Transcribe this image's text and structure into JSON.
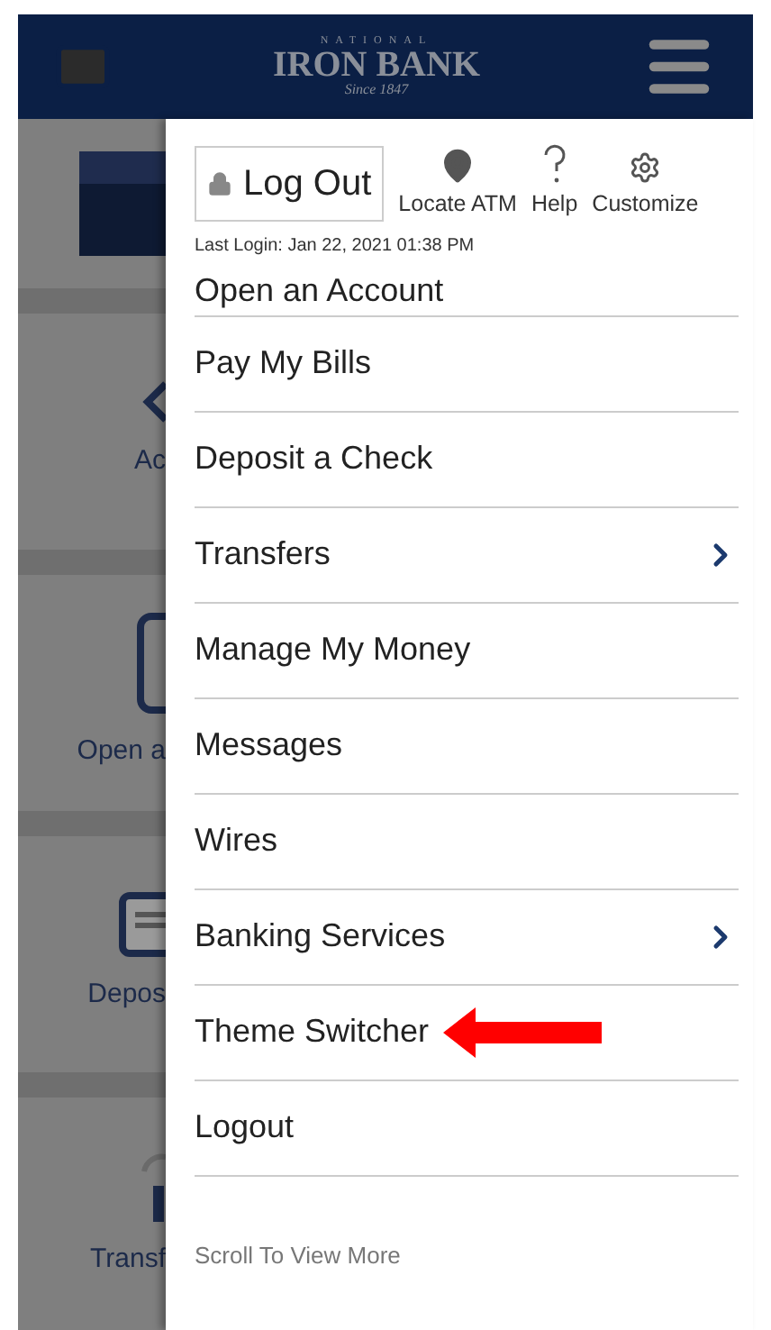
{
  "header": {
    "logo": {
      "top": "NATIONAL",
      "main": "IRON BANK",
      "tagline": "Since 1847"
    }
  },
  "background_tiles": [
    {
      "label": "Ac",
      "kind": "arrows"
    },
    {
      "label": "Open a",
      "kind": "card"
    },
    {
      "label": "Depos",
      "kind": "check"
    },
    {
      "label": "Transf",
      "kind": "transfer"
    }
  ],
  "menu": {
    "logout_button": "Log Out",
    "actions": [
      {
        "label": "Locate ATM",
        "kind": "pin"
      },
      {
        "label": "Help",
        "kind": "help"
      },
      {
        "label": "Customize",
        "kind": "gear"
      }
    ],
    "last_login": "Last Login: Jan 22, 2021 01:38 PM",
    "items": [
      {
        "label": "Open an Account",
        "has_children": false,
        "highlighted": false
      },
      {
        "label": "Pay My Bills",
        "has_children": false,
        "highlighted": false
      },
      {
        "label": "Deposit a Check",
        "has_children": false,
        "highlighted": false
      },
      {
        "label": "Transfers",
        "has_children": true,
        "highlighted": false
      },
      {
        "label": "Manage My Money",
        "has_children": false,
        "highlighted": false
      },
      {
        "label": "Messages",
        "has_children": false,
        "highlighted": false
      },
      {
        "label": "Wires",
        "has_children": false,
        "highlighted": false
      },
      {
        "label": "Banking Services",
        "has_children": true,
        "highlighted": false
      },
      {
        "label": "Theme Switcher",
        "has_children": false,
        "highlighted": true
      },
      {
        "label": "Logout",
        "has_children": false,
        "highlighted": false
      }
    ],
    "footer": "Scroll To View More"
  }
}
